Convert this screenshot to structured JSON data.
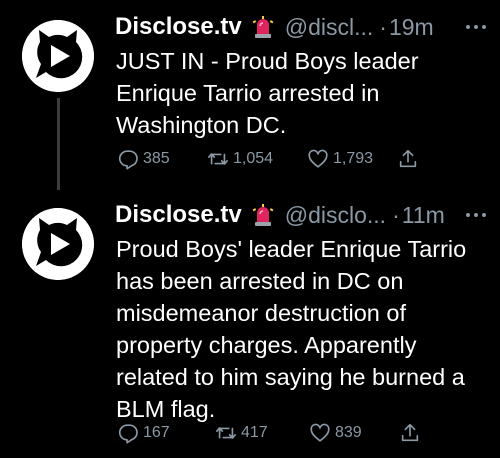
{
  "colors": {
    "background": "#000000",
    "text": "#ffffff",
    "secondary": "#8b98a5",
    "badge": "#e0245e"
  },
  "tweets": [
    {
      "author_name": "Disclose.tv",
      "badge_icon": "siren-emoji-icon",
      "handle": "@discl...",
      "separator": "·",
      "time": "19m",
      "text": "JUST IN - Proud Boys leader\nEnrique Tarrio arrested in\nWashington DC.",
      "replies": "385",
      "retweets": "1,054",
      "likes": "1,793"
    },
    {
      "author_name": "Disclose.tv",
      "badge_icon": "siren-emoji-icon",
      "handle": "@disclo...",
      "separator": "·",
      "time": "11m",
      "text": "Proud Boys' leader Enrique Tarrio\nhas been arrested in DC on\nmisdemeanor destruction of\nproperty charges. Apparently\nrelated to him saying he burned a\nBLM flag.",
      "replies": "167",
      "retweets": "417",
      "likes": "839"
    }
  ]
}
